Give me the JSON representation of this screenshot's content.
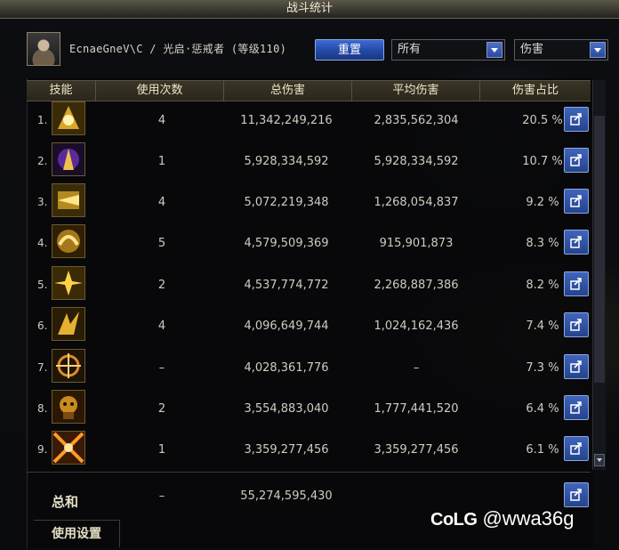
{
  "window": {
    "title": "战斗统计"
  },
  "header": {
    "character": "EcnaeGneV\\C / 光启·惩戒者 (等级110)",
    "reset_label": "重置",
    "filter_scope": "所有",
    "filter_type": "伤害"
  },
  "table": {
    "columns": [
      "技能",
      "使用次数",
      "总伤害",
      "平均伤害",
      "伤害占比"
    ],
    "rows": [
      {
        "rank": "1.",
        "uses": "4",
        "total": "11,342,249,216",
        "avg": "2,835,562,304",
        "pct": "20.5 %"
      },
      {
        "rank": "2.",
        "uses": "1",
        "total": "5,928,334,592",
        "avg": "5,928,334,592",
        "pct": "10.7 %"
      },
      {
        "rank": "3.",
        "uses": "4",
        "total": "5,072,219,348",
        "avg": "1,268,054,837",
        "pct": "9.2 %"
      },
      {
        "rank": "4.",
        "uses": "5",
        "total": "4,579,509,369",
        "avg": "915,901,873",
        "pct": "8.3 %"
      },
      {
        "rank": "5.",
        "uses": "2",
        "total": "4,537,774,772",
        "avg": "2,268,887,386",
        "pct": "8.2 %"
      },
      {
        "rank": "6.",
        "uses": "4",
        "total": "4,096,649,744",
        "avg": "1,024,162,436",
        "pct": "7.4 %"
      },
      {
        "rank": "7.",
        "uses": "–",
        "total": "4,028,361,776",
        "avg": "–",
        "pct": "7.3 %"
      },
      {
        "rank": "8.",
        "uses": "2",
        "total": "3,554,883,040",
        "avg": "1,777,441,520",
        "pct": "6.4 %"
      },
      {
        "rank": "9.",
        "uses": "1",
        "total": "3,359,277,456",
        "avg": "3,359,277,456",
        "pct": "6.1 %"
      }
    ],
    "total": {
      "label": "总和",
      "uses": "–",
      "total": "55,274,595,430"
    }
  },
  "footer": {
    "tab_label": "使用设置"
  },
  "watermark": {
    "logo": "CoLG",
    "handle": "@wwa36g"
  },
  "colors": {
    "accent_blue": "#2f57b8",
    "header_gold": "#f0e6c6",
    "icon_gold": "#d9a52a"
  }
}
